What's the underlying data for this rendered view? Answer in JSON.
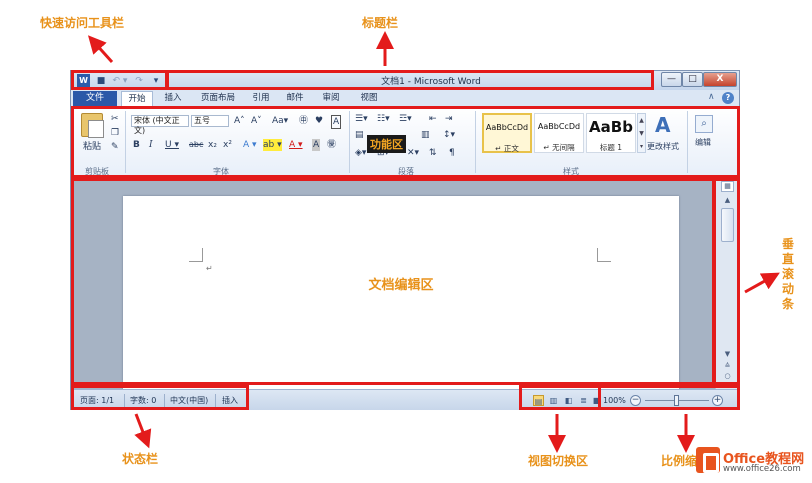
{
  "window": {
    "title": "文档1 - Microsoft Word",
    "word_icon": "W",
    "save_icon": "■",
    "undo_icon": "↶ ▾",
    "redo_icon": "↷",
    "qa_more_icon": "▾",
    "min_icon": "—",
    "max_icon": "□",
    "close_icon": "X"
  },
  "tabs": {
    "file": "文件",
    "home": "开始",
    "insert": "插入",
    "layout": "页面布局",
    "references": "引用",
    "mailings": "邮件",
    "review": "审阅",
    "view": "视图",
    "collapse_icon": "∧",
    "help_icon": "?"
  },
  "ribbon": {
    "clipboard": {
      "paste": "粘贴",
      "label": "剪贴板"
    },
    "font": {
      "name": "宋体 (中文正文)",
      "size": "五号",
      "grow": "A˄",
      "shrink": "A˅",
      "case": "Aa▾",
      "bold": "B",
      "italic": "I",
      "underline": "U ▾",
      "strike": "abc",
      "sub": "x₂",
      "sup": "x²",
      "label": "字体"
    },
    "paragraph": {
      "label": "段落"
    },
    "styles": {
      "normal_sample": "AaBbCcDd",
      "normal_name": "↵ 正文",
      "nospace_sample": "AaBbCcDd",
      "nospace_name": "↵ 无间隔",
      "h1_sample": "AaBb",
      "h1_name": "标题 1",
      "change": "更改样式",
      "label": "样式"
    },
    "editing": {
      "label": "编辑"
    },
    "overlay_label": "功能区"
  },
  "document": {
    "label": "文档编辑区",
    "caret": "↵"
  },
  "status": {
    "page": "页面: 1/1",
    "words": "字数: 0",
    "language": "中文(中国)",
    "mode": "插入",
    "zoom": "100%"
  },
  "annotations": {
    "quick_access": "快速访问工具栏",
    "title_bar": "标题栏",
    "scrollbar": "垂直滚动条",
    "status_bar": "状态栏",
    "view_switch": "视图切换区",
    "zoom_area": "比例缩"
  },
  "logo": {
    "title": "Office教程网",
    "url": "www.office26.com"
  },
  "colors": {
    "highlight": "#e31b1b",
    "annotation": "#e8921b",
    "file_tab": "#2b58a8",
    "logo": "#e8541e"
  }
}
